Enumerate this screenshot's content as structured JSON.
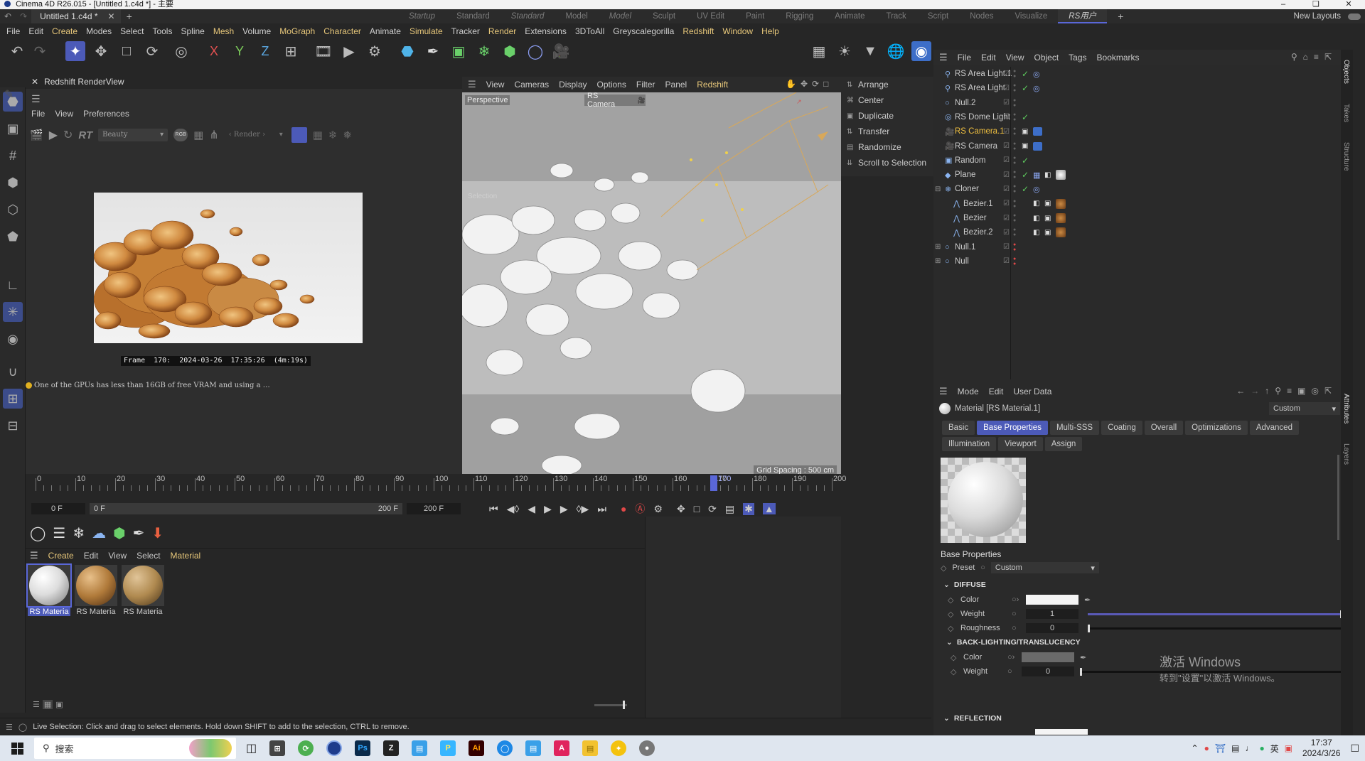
{
  "window": {
    "title": "Cinema 4D R26.015 - [Untitled 1.c4d *] - 主要"
  },
  "tabs": {
    "doc_tab": "Untitled 1.c4d *",
    "layouts": [
      "Startup",
      "Standard",
      "Standard",
      "Model",
      "Model",
      "Sculpt",
      "UV Edit",
      "Paint",
      "Rigging",
      "Animate",
      "Track",
      "Script",
      "Nodes",
      "Visualize",
      "RS用户"
    ],
    "new_layouts": "New Layouts"
  },
  "menubar": [
    "File",
    "Edit",
    "Create",
    "Modes",
    "Select",
    "Tools",
    "Spline",
    "Mesh",
    "Volume",
    "MoGraph",
    "Character",
    "Animate",
    "Simulate",
    "Tracker",
    "Render",
    "Extensions",
    "3DToAll",
    "Greyscalegorilla",
    "Redshift",
    "Window",
    "Help"
  ],
  "toolbar_axes": [
    "X",
    "Y",
    "Z"
  ],
  "renderview": {
    "title": "Redshift RenderView",
    "menu": [
      "File",
      "View",
      "Preferences"
    ],
    "rt_label": "RT",
    "aov_select": "Beauty",
    "render_select": "Render",
    "frame_info": "Frame  170:  2024-03-26  17:35:26  (4m:19s)",
    "warning": "One of the GPUs has less than 16GB of free VRAM and using a …"
  },
  "viewport": {
    "menu": [
      "View",
      "Cameras",
      "Display",
      "Options",
      "Filter",
      "Panel",
      "Redshift"
    ],
    "label_view": "Perspective",
    "label_camera": "RS Camera",
    "grid_spacing": "Grid Spacing : 500 cm",
    "hud_selection": "Selection"
  },
  "command_menu": [
    "Arrange",
    "Center",
    "Duplicate",
    "Transfer",
    "Randomize",
    "Scroll to Selection"
  ],
  "object_manager": {
    "menu": [
      "File",
      "Edit",
      "View",
      "Object",
      "Tags",
      "Bookmarks"
    ],
    "objects": [
      {
        "name": "RS Area Light.1",
        "selected": false
      },
      {
        "name": "RS Area Light",
        "selected": false
      },
      {
        "name": "Null.2",
        "selected": false
      },
      {
        "name": "RS Dome Light",
        "selected": false
      },
      {
        "name": "RS Camera.1",
        "selected": true
      },
      {
        "name": "RS Camera",
        "selected": false
      },
      {
        "name": "Random",
        "selected": false
      },
      {
        "name": "Plane",
        "selected": false
      },
      {
        "name": "Cloner",
        "selected": false
      },
      {
        "name": "Bezier.1",
        "selected": false
      },
      {
        "name": "Bezier",
        "selected": false
      },
      {
        "name": "Bezier.2",
        "selected": false
      },
      {
        "name": "Null.1",
        "selected": false
      },
      {
        "name": "Null",
        "selected": false
      }
    ],
    "side_tabs": [
      "Objects",
      "Takes",
      "Structure"
    ]
  },
  "attributes": {
    "menu": [
      "Mode",
      "Edit",
      "User Data"
    ],
    "material_title": "Material [RS Material.1]",
    "preset_select": "Custom",
    "tabs_row1": [
      "Basic",
      "Base Properties",
      "Multi-SSS",
      "Coating",
      "Overall",
      "Optimizations",
      "Advanced"
    ],
    "tabs_row2": [
      "Illumination",
      "Viewport",
      "Assign"
    ],
    "active_tab": "Base Properties",
    "section_title": "Base Properties",
    "preset_label": "Preset",
    "preset_value": "Custom",
    "diffuse_header": "DIFFUSE",
    "color_label": "Color",
    "weight_label": "Weight",
    "weight_value": "1",
    "roughness_label": "Roughness",
    "roughness_value": "0",
    "backlight_header": "BACK-LIGHTING/TRANSLUCENCY",
    "bl_color_label": "Color",
    "bl_weight_label": "Weight",
    "bl_weight_value": "0",
    "reflection_header": "REFLECTION",
    "side_tabs": [
      "Attributes",
      "Layers"
    ],
    "watermark_line1": "激活 Windows",
    "watermark_line2": "转到\"设置\"以激活 Windows。"
  },
  "timeline": {
    "ticks": [
      "0",
      "10",
      "20",
      "30",
      "40",
      "50",
      "60",
      "70",
      "80",
      "90",
      "100",
      "110",
      "120",
      "130",
      "140",
      "150",
      "160",
      "170",
      "180",
      "190",
      "200"
    ],
    "current_frame_marker": "170",
    "start_field": "0 F",
    "min_field": "0 F",
    "max_field": "200 F",
    "end_field": "200 F"
  },
  "material_manager": {
    "menu": [
      "Create",
      "Edit",
      "View",
      "Select",
      "Material"
    ],
    "materials": [
      {
        "label": "RS Materia",
        "kind": "white",
        "selected": true
      },
      {
        "label": "RS Materia",
        "kind": "tan",
        "selected": false
      },
      {
        "label": "RS Materia",
        "kind": "tan2",
        "selected": false
      }
    ]
  },
  "status_text": "Live Selection: Click and drag to select elements. Hold down SHIFT to add to the selection, CTRL to remove.",
  "taskbar": {
    "search_label": "搜索",
    "time": "17:37",
    "date": "2024/3/26",
    "ime": "英"
  },
  "colors": {
    "accent": "#5a67d8",
    "highlight_menu": "#e7c77a",
    "selected_object": "#f0c040",
    "green_check": "#5ecb5e"
  }
}
